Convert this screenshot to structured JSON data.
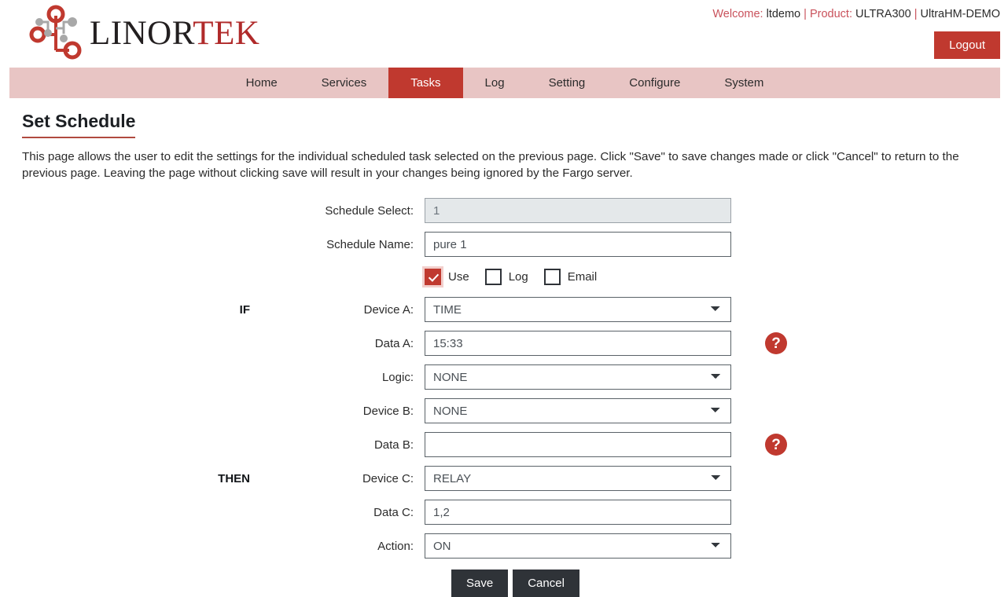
{
  "brand": {
    "name_dark": "LINOR",
    "name_red": "TEK",
    "logo_icon": "circuit-tree-icon"
  },
  "header": {
    "welcome_label": "Welcome:",
    "user": "ltdemo",
    "separator": "|",
    "product_label": "Product:",
    "product": "ULTRA300",
    "device": "UltraHM-DEMO",
    "logout_label": "Logout"
  },
  "nav": {
    "items": [
      {
        "label": "Home",
        "active": false
      },
      {
        "label": "Services",
        "active": false
      },
      {
        "label": "Tasks",
        "active": true
      },
      {
        "label": "Log",
        "active": false
      },
      {
        "label": "Setting",
        "active": false
      },
      {
        "label": "Configure",
        "active": false
      },
      {
        "label": "System",
        "active": false
      }
    ]
  },
  "page": {
    "title": "Set Schedule",
    "description": "This page allows the user to edit the settings for the individual scheduled task selected on the previous page. Click \"Save\" to save changes made or click \"Cancel\" to return to the previous page. Leaving the page without clicking save will result in your changes being ignored by the Fargo server."
  },
  "form": {
    "schedule_select": {
      "label": "Schedule Select:",
      "value": "1"
    },
    "schedule_name": {
      "label": "Schedule Name:",
      "value": "pure 1"
    },
    "checkboxes": [
      {
        "label": "Use",
        "checked": true
      },
      {
        "label": "Log",
        "checked": false
      },
      {
        "label": "Email",
        "checked": false
      }
    ],
    "if_label": "IF",
    "then_label": "THEN",
    "device_a": {
      "label": "Device A:",
      "value": "TIME"
    },
    "data_a": {
      "label": "Data A:",
      "value": "15:33"
    },
    "logic": {
      "label": "Logic:",
      "value": "NONE"
    },
    "device_b": {
      "label": "Device B:",
      "value": "NONE"
    },
    "data_b": {
      "label": "Data B:",
      "value": ""
    },
    "device_c": {
      "label": "Device C:",
      "value": "RELAY"
    },
    "data_c": {
      "label": "Data C:",
      "value": "1,2"
    },
    "action": {
      "label": "Action:",
      "value": "ON"
    },
    "help_icon": "question-mark-icon",
    "save_label": "Save",
    "cancel_label": "Cancel"
  },
  "colors": {
    "brand_red": "#c0392f",
    "nav_bg": "#e8c5c4",
    "button_dark": "#2f3338",
    "welcome_red": "#c9515b"
  }
}
